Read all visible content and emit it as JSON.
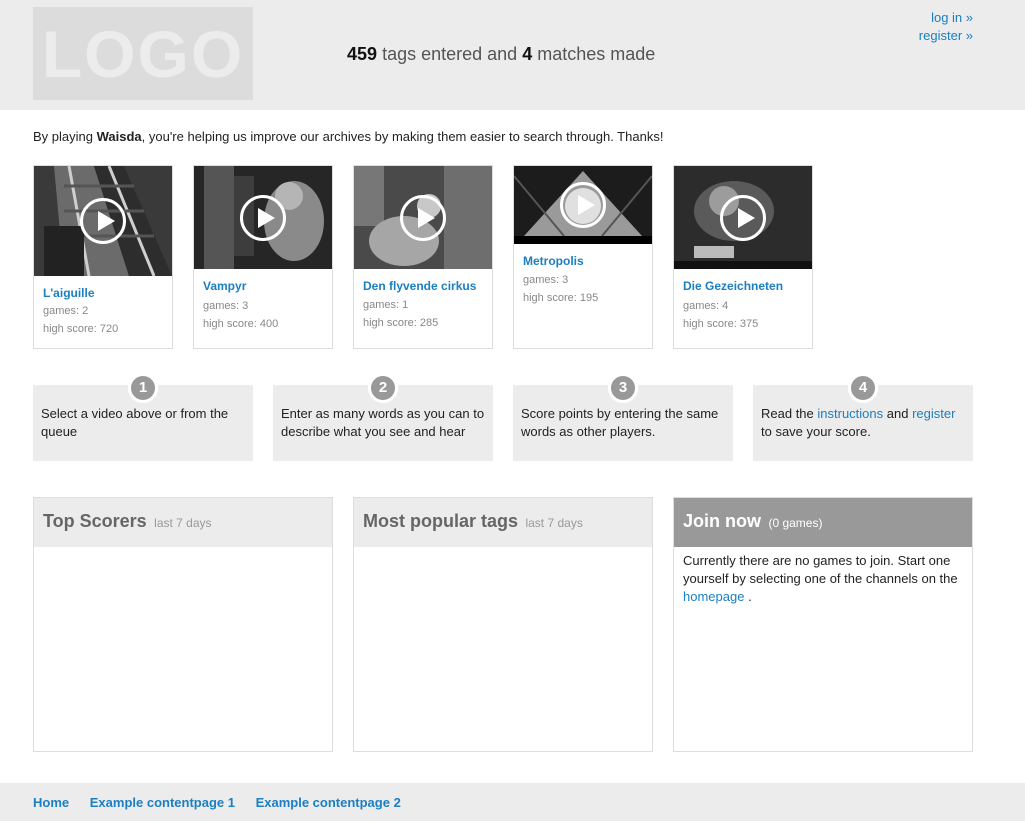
{
  "header": {
    "logo_text": "LOGO",
    "stats": {
      "tags": "459",
      "tags_label": "tags entered and",
      "matches": "4",
      "matches_label": "matches made"
    },
    "login_label": "log in »",
    "register_label": "register »"
  },
  "intro": {
    "prefix": "By playing",
    "brand": "Waisda",
    "suffix": ", you're helping us improve our archives by making them easier to search through. Thanks!"
  },
  "videos": [
    {
      "title": "L'aiguille",
      "games": "games: 2",
      "high_score": "high score: 720"
    },
    {
      "title": "Vampyr",
      "games": "games: 3",
      "high_score": "high score: 400"
    },
    {
      "title": "Den flyvende cirkus",
      "games": "games: 1",
      "high_score": "high score: 285"
    },
    {
      "title": "Metropolis",
      "games": "games: 3",
      "high_score": "high score: 195"
    },
    {
      "title": "Die Gezeichneten",
      "games": "games: 4",
      "high_score": "high score: 375"
    }
  ],
  "steps": [
    {
      "num": "1",
      "text": "Select a video above or from the queue"
    },
    {
      "num": "2",
      "text": "Enter as many words as you can to describe what you see and hear"
    },
    {
      "num": "3",
      "text": "Score points by entering the same words as other players."
    },
    {
      "num": "4",
      "text_before": "Read the",
      "link1": "instructions",
      "text_mid": "and",
      "link2": "register",
      "text_after": "to save your score."
    }
  ],
  "panels": {
    "top_scorers": {
      "title": "Top Scorers",
      "sub": "last 7 days"
    },
    "popular_tags": {
      "title": "Most popular tags",
      "sub": "last 7 days"
    },
    "join": {
      "title": "Join now",
      "sub": "(0 games)",
      "body": "Currently there are no games to join. Start one yourself by selecting one of the channels on the",
      "link": "homepage",
      "body_end": "."
    }
  },
  "footer": {
    "links": [
      "Home",
      "Example contentpage 1",
      "Example contentpage 2"
    ]
  },
  "colors": {
    "link": "#1b7fc1",
    "header_bg": "#ececec",
    "join_head": "#999999"
  },
  "icons": {
    "play": "play-circle-icon"
  }
}
